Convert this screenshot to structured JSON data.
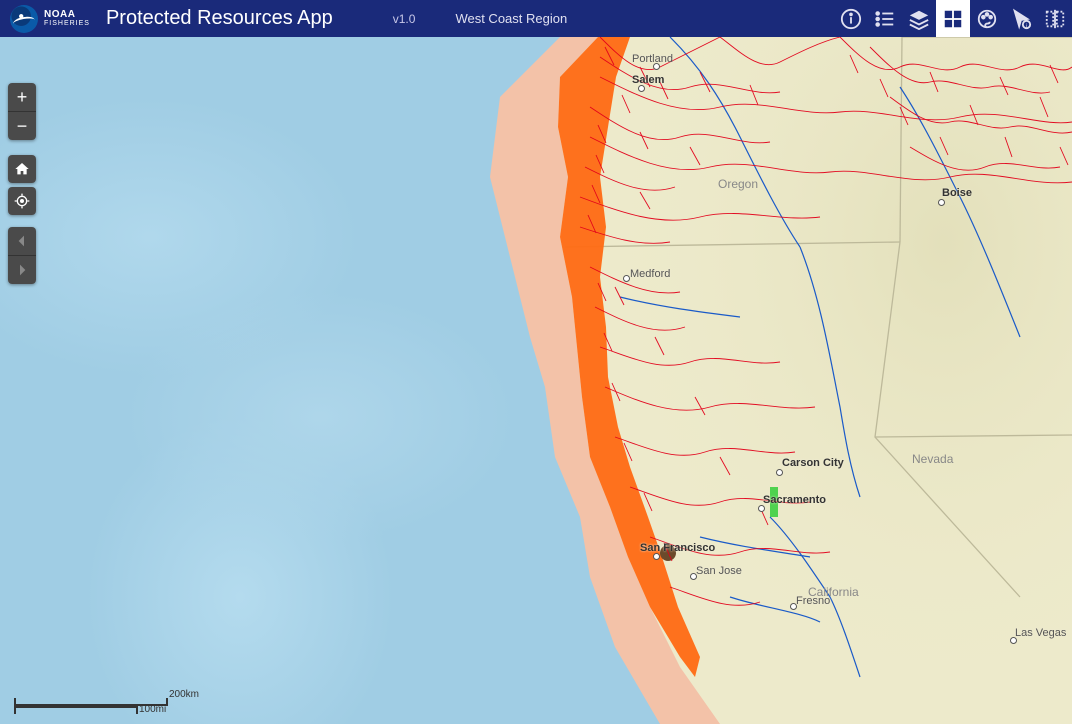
{
  "header": {
    "logo_text_top": "NOAA",
    "logo_text_bottom": "FISHERIES",
    "title": "Protected Resources App",
    "version": "v1.0",
    "region": "West Coast Region"
  },
  "scalebar": {
    "top_label": "200km",
    "bottom_label": "100mi"
  },
  "labels": {
    "states": {
      "oregon": "Oregon",
      "california": "California",
      "nevada": "Nevada"
    },
    "cities": {
      "portland": "Portland",
      "salem": "Salem",
      "medford": "Medford",
      "boise": "Boise",
      "carson_city": "Carson City",
      "sacramento": "Sacramento",
      "san_francisco": "San Francisco",
      "san_jose": "San Jose",
      "fresno": "Fresno",
      "las_vegas": "Las Vegas"
    }
  }
}
